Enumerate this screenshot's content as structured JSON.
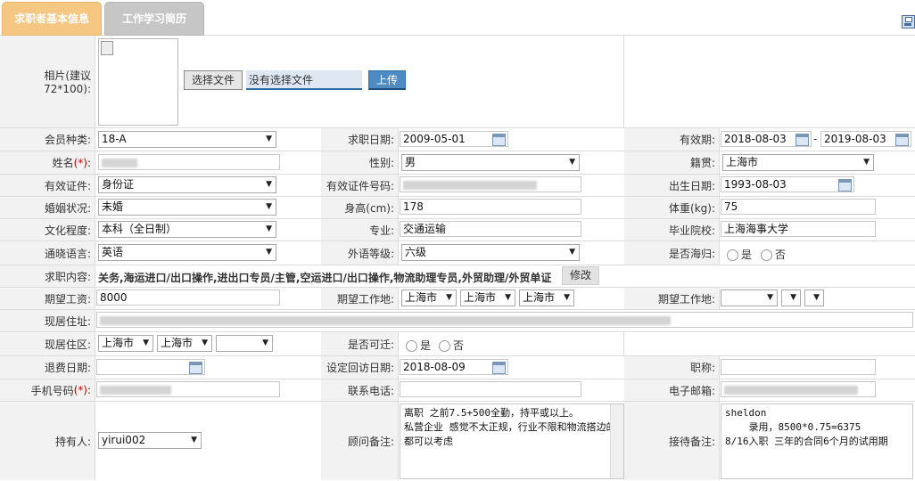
{
  "tabs": [
    {
      "label": "求职者基本信息"
    },
    {
      "label": "工作学习简历"
    }
  ],
  "photo": {
    "label": "相片(建议72*100):",
    "choose_btn": "选择文件",
    "no_file": "没有选择文件",
    "upload_btn": "上传"
  },
  "member_type": {
    "label": "会员种类:",
    "value": "18-A"
  },
  "apply_date": {
    "label": "求职日期:",
    "value": "2009-05-01"
  },
  "validity": {
    "label": "有效期:",
    "from": "2018-08-03",
    "sep": "-",
    "to": "2019-08-03"
  },
  "name": {
    "label": "姓名",
    "req": "(*)",
    "colon": ":"
  },
  "gender": {
    "label": "性别:",
    "value": "男"
  },
  "native": {
    "label": "籍贯:",
    "value": "上海市"
  },
  "id_type": {
    "label": "有效证件:",
    "value": "身份证"
  },
  "id_no": {
    "label": "有效证件号码:"
  },
  "birth": {
    "label": "出生日期:",
    "value": "1993-08-03"
  },
  "marital": {
    "label": "婚姻状况:",
    "value": "未婚"
  },
  "height": {
    "label": "身高(cm):",
    "value": "178"
  },
  "weight": {
    "label": "体重(kg):",
    "value": "75"
  },
  "education": {
    "label": "文化程度:",
    "value": "本科（全日制）"
  },
  "major": {
    "label": "专业:",
    "value": "交通运输"
  },
  "school": {
    "label": "毕业院校:",
    "value": "上海海事大学"
  },
  "language": {
    "label": "通晓语言:",
    "value": "英语"
  },
  "lang_level": {
    "label": "外语等级:",
    "value": "六级"
  },
  "returnee": {
    "label": "是否海归:",
    "yes": "是",
    "no": "否"
  },
  "job_content": {
    "label": "求职内容:",
    "value": "关务,海运进口/出口操作,进出口专员/主管,空运进口/出口操作,物流助理专员,外贸助理/外贸单证",
    "edit_btn": "修改"
  },
  "salary": {
    "label": "期望工资:",
    "value": "8000"
  },
  "work_place": {
    "label": "期望工作地:",
    "p1": "上海市",
    "p2": "上海市",
    "p3": "上海市"
  },
  "work_place2": {
    "label": "期望工作地:"
  },
  "address": {
    "label": "现居住址:"
  },
  "district": {
    "label": "现居住区:",
    "p1": "上海市",
    "p2": "上海市",
    "p3": ""
  },
  "relocate": {
    "label": "是否可迁:",
    "yes": "是",
    "no": "否"
  },
  "refund_date": {
    "label": "退费日期:",
    "value": ""
  },
  "visit_date": {
    "label": "设定回访日期:",
    "value": "2018-08-09"
  },
  "title": {
    "label": "职称:",
    "value": ""
  },
  "mobile": {
    "label": "手机号码",
    "req": "(*)",
    "colon": ":"
  },
  "phone": {
    "label": "联系电话:",
    "value": ""
  },
  "email": {
    "label": "电子邮箱:"
  },
  "holder": {
    "label": "持有人:",
    "value": "yirui002"
  },
  "consultant_note": {
    "label": "顾问备注:",
    "value": "离职 之前7.5+500全勤，持平或以上。\n私营企业 感觉不太正规，行业不限和物流搭边的都可以考虑"
  },
  "reception_note": {
    "label": "接待备注:",
    "value": "sheldon\n    录用，8500*0.75=6375\n8/16入职 三年的合同6个月的试用期"
  },
  "colors": {
    "tab_active": "#f6c683",
    "tab_inactive": "#c6c6c6",
    "label_bg": "#f2f2f2",
    "required": "#cc0000"
  },
  "icons": [
    "save-icon",
    "calendar-icon",
    "dropdown-arrow-icon",
    "radio-icon"
  ]
}
